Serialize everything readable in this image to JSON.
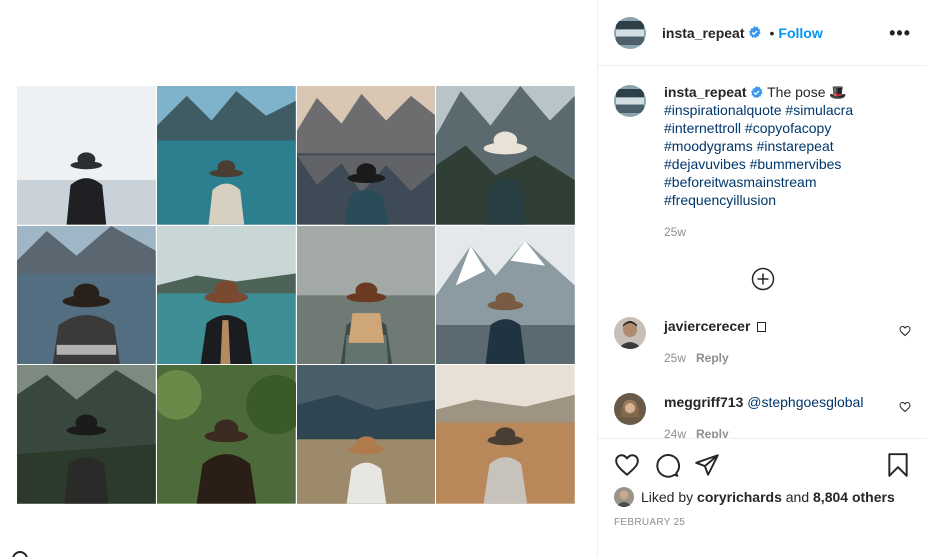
{
  "post": {
    "username": "insta_repeat",
    "follow_label": "Follow",
    "more_label": "•••",
    "dot": "•"
  },
  "caption": {
    "username": "insta_repeat",
    "text": "The pose 🎩",
    "hashtags_line1": "#inspirationalquote #simulacra",
    "hashtags_line2": "#internettroll #copyofacopy",
    "hashtags_line3": "#moodygrams #instarepeat",
    "hashtags_line4": "#dejavuvibes #bummervibes",
    "hashtags_line5": "#beforeitwasmainstream",
    "hashtags_line6": "#frequencyillusion",
    "time": "25w"
  },
  "comments": [
    {
      "username": "javiercerecer",
      "text": "",
      "time": "25w",
      "reply": "Reply"
    },
    {
      "username": "meggriff713",
      "text": "@stephgoesglobal",
      "time": "24w",
      "reply": "Reply"
    }
  ],
  "likes": {
    "prefix": "Liked by",
    "user": "coryrichards",
    "and": "and",
    "count": "8,804 others"
  },
  "date": "FEBRUARY 25",
  "icons": [
    "heart-icon",
    "comment-icon",
    "share-icon",
    "bookmark-icon",
    "verified-icon",
    "add-circle-icon",
    "more-icon"
  ],
  "colors": {
    "link": "#00376b",
    "follow": "#0095f6",
    "meta": "#8e8e8e",
    "verified": "#3897f0"
  }
}
